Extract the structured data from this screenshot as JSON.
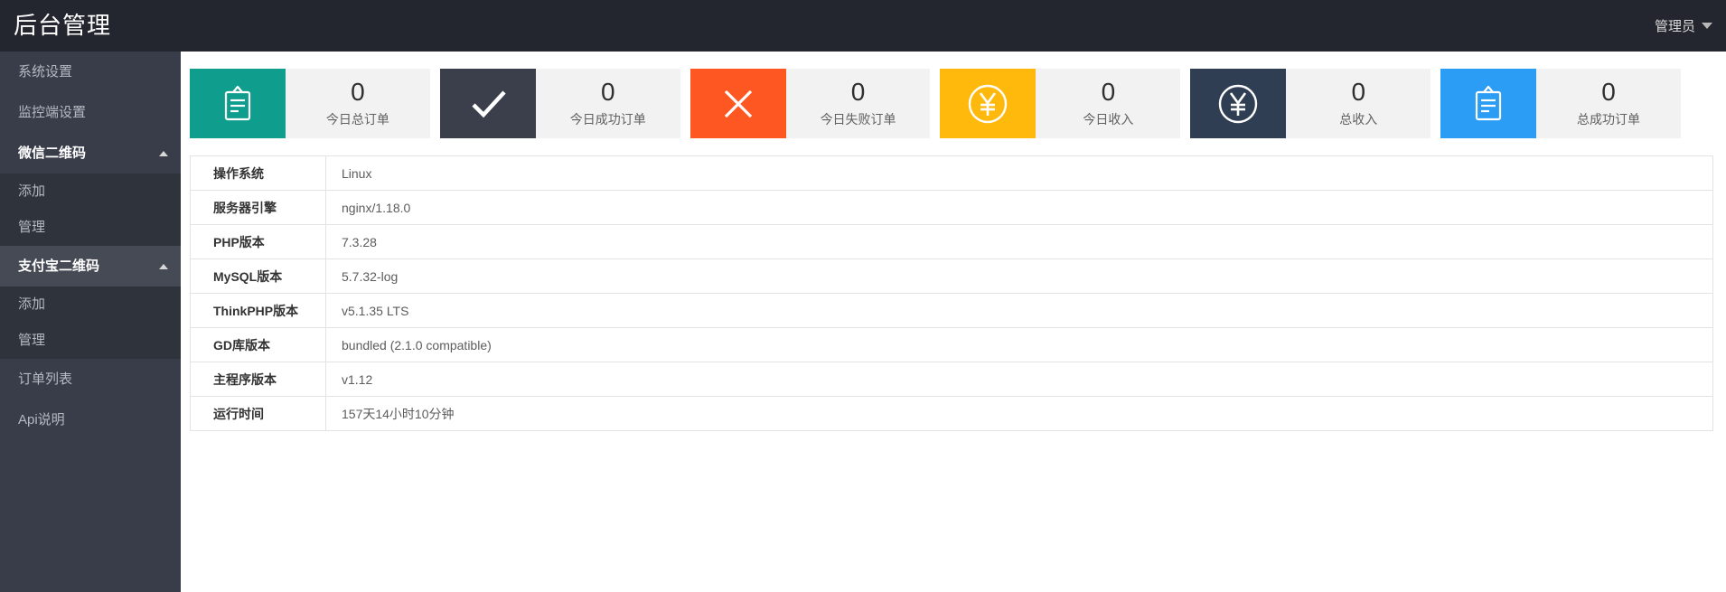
{
  "header": {
    "title": "后台管理",
    "user_menu": {
      "label": "管理员",
      "icon": "chevron-down-icon"
    }
  },
  "sidebar": {
    "items": [
      {
        "label": "系统设置",
        "type": "item"
      },
      {
        "label": "监控端设置",
        "type": "item"
      },
      {
        "label": "微信二维码",
        "type": "section",
        "expanded": true,
        "icon": "chevron-up-icon"
      },
      {
        "label": "添加",
        "type": "subitem",
        "parent": "微信二维码"
      },
      {
        "label": "管理",
        "type": "subitem",
        "parent": "微信二维码"
      },
      {
        "label": "支付宝二维码",
        "type": "section",
        "expanded": true,
        "highlighted": true,
        "icon": "chevron-up-icon"
      },
      {
        "label": "添加",
        "type": "subitem",
        "parent": "支付宝二维码"
      },
      {
        "label": "管理",
        "type": "subitem",
        "parent": "支付宝二维码"
      },
      {
        "label": "订单列表",
        "type": "item"
      },
      {
        "label": "Api说明",
        "type": "item"
      }
    ]
  },
  "stats": {
    "cards": [
      {
        "icon": "clipboard-icon",
        "color": "#0F9D8D",
        "value": "0",
        "label": "今日总订单"
      },
      {
        "icon": "check-icon",
        "color": "#3A3F4B",
        "value": "0",
        "label": "今日成功订单"
      },
      {
        "icon": "cross-icon",
        "color": "#FF5722",
        "value": "0",
        "label": "今日失败订单"
      },
      {
        "icon": "yen-icon",
        "color": "#FFB80C",
        "value": "0",
        "label": "今日收入"
      },
      {
        "icon": "yen-icon",
        "color": "#2F3E53",
        "value": "0",
        "label": "总收入"
      },
      {
        "icon": "clipboard-icon",
        "color": "#2B9DF4",
        "value": "0",
        "label": "总成功订单"
      }
    ]
  },
  "system_table": {
    "rows": [
      {
        "label": "操作系统",
        "value": "Linux"
      },
      {
        "label": "服务器引擎",
        "value": "nginx/1.18.0"
      },
      {
        "label": "PHP版本",
        "value": "7.3.28"
      },
      {
        "label": "MySQL版本",
        "value": "5.7.32-log"
      },
      {
        "label": "ThinkPHP版本",
        "value": "v5.1.35 LTS"
      },
      {
        "label": "GD库版本",
        "value": "bundled (2.1.0 compatible)"
      },
      {
        "label": "主程序版本",
        "value": "v1.12"
      },
      {
        "label": "运行时间",
        "value": "157天14小时10分钟"
      }
    ]
  },
  "colors": {
    "header_bg": "#23262E",
    "sidebar_bg": "#393D49",
    "submenu_bg": "#2F333C",
    "card_info_bg": "#F2F2F2",
    "table_border": "#E3E3E3"
  }
}
